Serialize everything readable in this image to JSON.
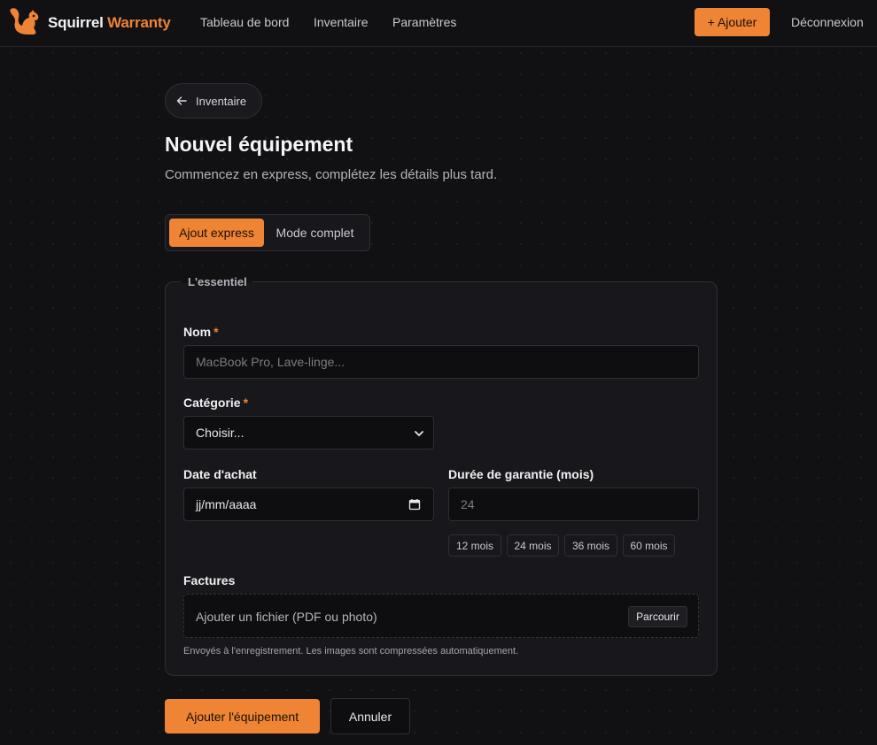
{
  "nav": {
    "logo_icon": "squirrel-icon",
    "brand_part1": "Squirrel",
    "brand_part2": "Warranty",
    "links": [
      "Tableau de bord",
      "Inventaire",
      "Paramètres"
    ],
    "add_button": "+ Ajouter",
    "logout": "Déconnexion"
  },
  "header": {
    "back_label": "Inventaire",
    "back_icon": "arrow-left-icon",
    "title": "Nouvel équipement",
    "subtitle": "Commencez en express, complétez les détails plus tard."
  },
  "modes": {
    "express": "Ajout express",
    "complete": "Mode complet",
    "selected": "express"
  },
  "form": {
    "legend": "L'essentiel",
    "name": {
      "label": "Nom",
      "required_mark": "*",
      "placeholder": "MacBook Pro, Lave-linge..."
    },
    "category": {
      "label": "Catégorie",
      "required_mark": "*",
      "value": "Choisir..."
    },
    "purchase_date": {
      "label": "Date d'achat",
      "value": "jj/mm/aaaa"
    },
    "warranty": {
      "label": "Durée de garantie (mois)",
      "placeholder": "24",
      "chips": [
        "12 mois",
        "24 mois",
        "36 mois",
        "60 mois"
      ]
    },
    "invoices": {
      "label": "Factures",
      "dropzone_text": "Ajouter un fichier (PDF ou photo)",
      "browse": "Parcourir",
      "hint": "Envoyés à l'enregistrement. Les images sont compressées automatiquement."
    }
  },
  "actions": {
    "submit": "Ajouter l'équipement",
    "cancel": "Annuler"
  },
  "colors": {
    "accent": "#ee8434",
    "background": "#111114",
    "surface": "#18181c"
  }
}
